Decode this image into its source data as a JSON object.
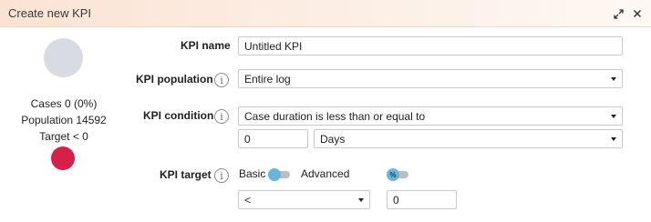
{
  "dialog": {
    "title": "Create new KPI",
    "expand_icon": "expand-icon",
    "close_icon": "close-icon"
  },
  "summary": {
    "cases_label": "Cases",
    "cases_value": "0 (0%)",
    "population_label": "Population",
    "population_value": "14592",
    "target_label": "Target",
    "target_value": "< 0",
    "status_color": "#d6204a"
  },
  "form": {
    "kpi_name": {
      "label": "KPI name",
      "value": "Untitled KPI"
    },
    "kpi_population": {
      "label": "KPI population",
      "value": "Entire log",
      "info_icon": "info-icon"
    },
    "kpi_condition": {
      "label": "KPI condition",
      "value": "Case duration is less than or equal to",
      "amount": "0",
      "unit": "Days",
      "info_icon": "info-icon"
    },
    "kpi_target": {
      "label": "KPI target",
      "basic_label": "Basic",
      "advanced_label": "Advanced",
      "mode_selected": "Basic",
      "percent_toggle_label": "%",
      "operator": "<",
      "value": "0",
      "info_icon": "info-icon"
    }
  },
  "colors": {
    "accent": "#66b6de",
    "title_bar": "#fbe3d4",
    "neutral_circle": "#d8dbe1"
  }
}
